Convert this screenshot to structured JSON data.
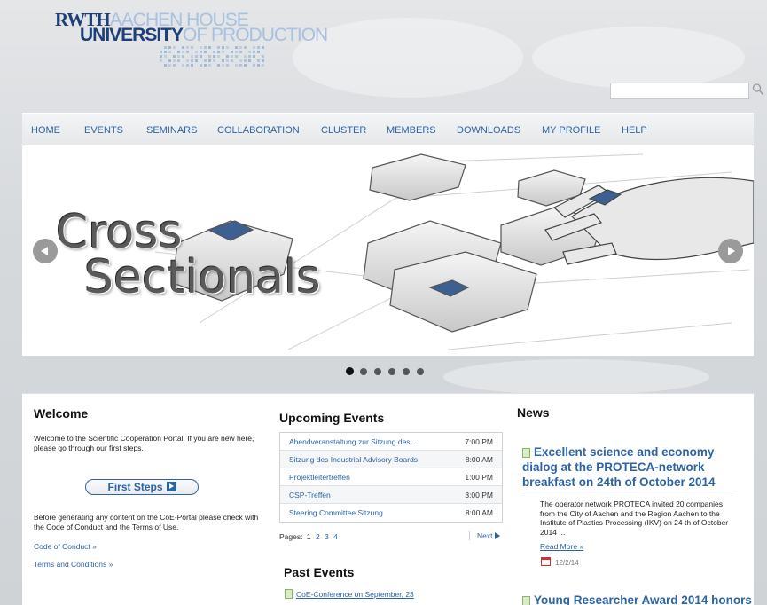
{
  "logo": {
    "line1_dark": "RWTH",
    "line1_light": "AACHEN HOUSE",
    "line2_dark": "UNIVERSITY",
    "line2_light": "OF PRODUCTION"
  },
  "search": {
    "value": "",
    "placeholder": ""
  },
  "nav": {
    "items": [
      "HOME",
      "EVENTS",
      "SEMINARS",
      "COLLABORATION",
      "CLUSTER",
      "MEMBERS",
      "DOWNLOADS",
      "MY PROFILE",
      "HELP"
    ]
  },
  "hero": {
    "title_line1": "Cross",
    "title_line2": "Sectionals",
    "slide_count": 6,
    "active_slide": 1
  },
  "welcome": {
    "title": "Welcome",
    "intro": "Welcome to the Scientific Cooperation Portal. If you are new here, please go through our first steps.",
    "button": "First Steps",
    "note": "Before generating any content on the CoE-Portal please check with the Code of Conduct and the Terms of Use.",
    "link_conduct": "Code of Conduct »",
    "link_terms": "Terms and Conditions »"
  },
  "upcoming_events": {
    "title": "Upcoming Events",
    "rows": [
      {
        "name": "Abendveranstaltung zur Sitzung des...",
        "time": "7:00 PM"
      },
      {
        "name": "Sitzung des Industrial Advisory Boards",
        "time": "8:00 AM"
      },
      {
        "name": "Projektleitertreffen",
        "time": "1:00 PM"
      },
      {
        "name": "CSP-Treffen",
        "time": "3:00 PM"
      },
      {
        "name": "Steering Committee Sitzung",
        "time": "8:00 AM"
      }
    ],
    "pages_label": "Pages:",
    "pages": [
      "1",
      "2",
      "3",
      "4"
    ],
    "next": "Next"
  },
  "past_events": {
    "title": "Past Events",
    "item": "CoE-Conference on September, 23"
  },
  "news": {
    "title": "News",
    "headline": "Excellent science and economy dialog at the PROTECA-network breakfast on 24th of October 2014",
    "body": "The operator network PROTECA invited 20 companies from the City of Aachen and the Region Aachen to the Institute of Plastics Processing (IKV) on 24 th of October 2014 ...",
    "read_more": "Read More »",
    "date": "12/2/14",
    "headline2": "Young Researcher Award 2014 honors"
  },
  "colors": {
    "accent": "#2c63a5",
    "brand_dark": "#1d3f78",
    "brand_light": "#a8c1e0"
  }
}
